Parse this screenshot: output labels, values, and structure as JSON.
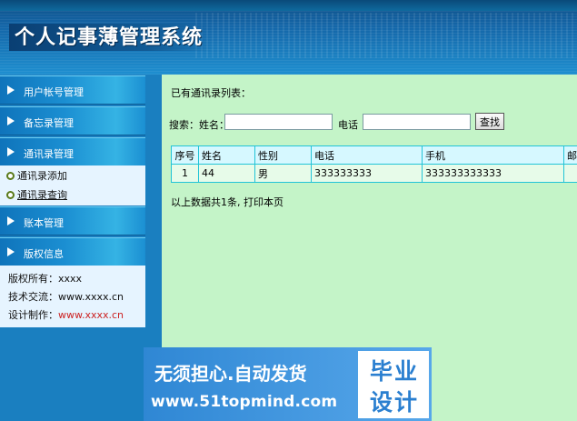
{
  "header": {
    "title": "个人记事薄管理系统"
  },
  "sidebar": {
    "items": [
      {
        "label": "用户帐号管理"
      },
      {
        "label": "备忘录管理"
      },
      {
        "label": "通讯录管理"
      },
      {
        "label": "账本管理"
      },
      {
        "label": "版权信息"
      }
    ],
    "submenu": [
      {
        "label": "通讯录添加"
      },
      {
        "label": "通讯录查询"
      }
    ],
    "info": {
      "copyright_label": "版权所有：",
      "copyright_value": "xxxx",
      "tech_label": "技术交流：",
      "tech_value": "www.xxxx.cn",
      "design_label": "设计制作：",
      "design_value": "www.xxxx.cn"
    }
  },
  "main": {
    "list_title": "已有通讯录列表：",
    "search": {
      "prefix_label": "搜索：姓名：",
      "name_value": "",
      "phone_label": "电话",
      "phone_value": "",
      "button_label": "查找"
    },
    "table": {
      "columns": [
        "序号",
        "姓名",
        "性别",
        "电话",
        "手机",
        "邮"
      ],
      "rows": [
        [
          "1",
          "44",
          "男",
          "333333333",
          "333333333333",
          ""
        ]
      ]
    },
    "footer": "以上数据共1条, 打印本页"
  },
  "watermark": {
    "line1": "无须担心.自动发货",
    "line2": "www.51topmind.com",
    "right1": "毕业",
    "right2": "设计"
  },
  "colors": {
    "header_blue": "#1466a8",
    "main_bg": "#c4f4c8",
    "table_border": "#22c4d7"
  }
}
